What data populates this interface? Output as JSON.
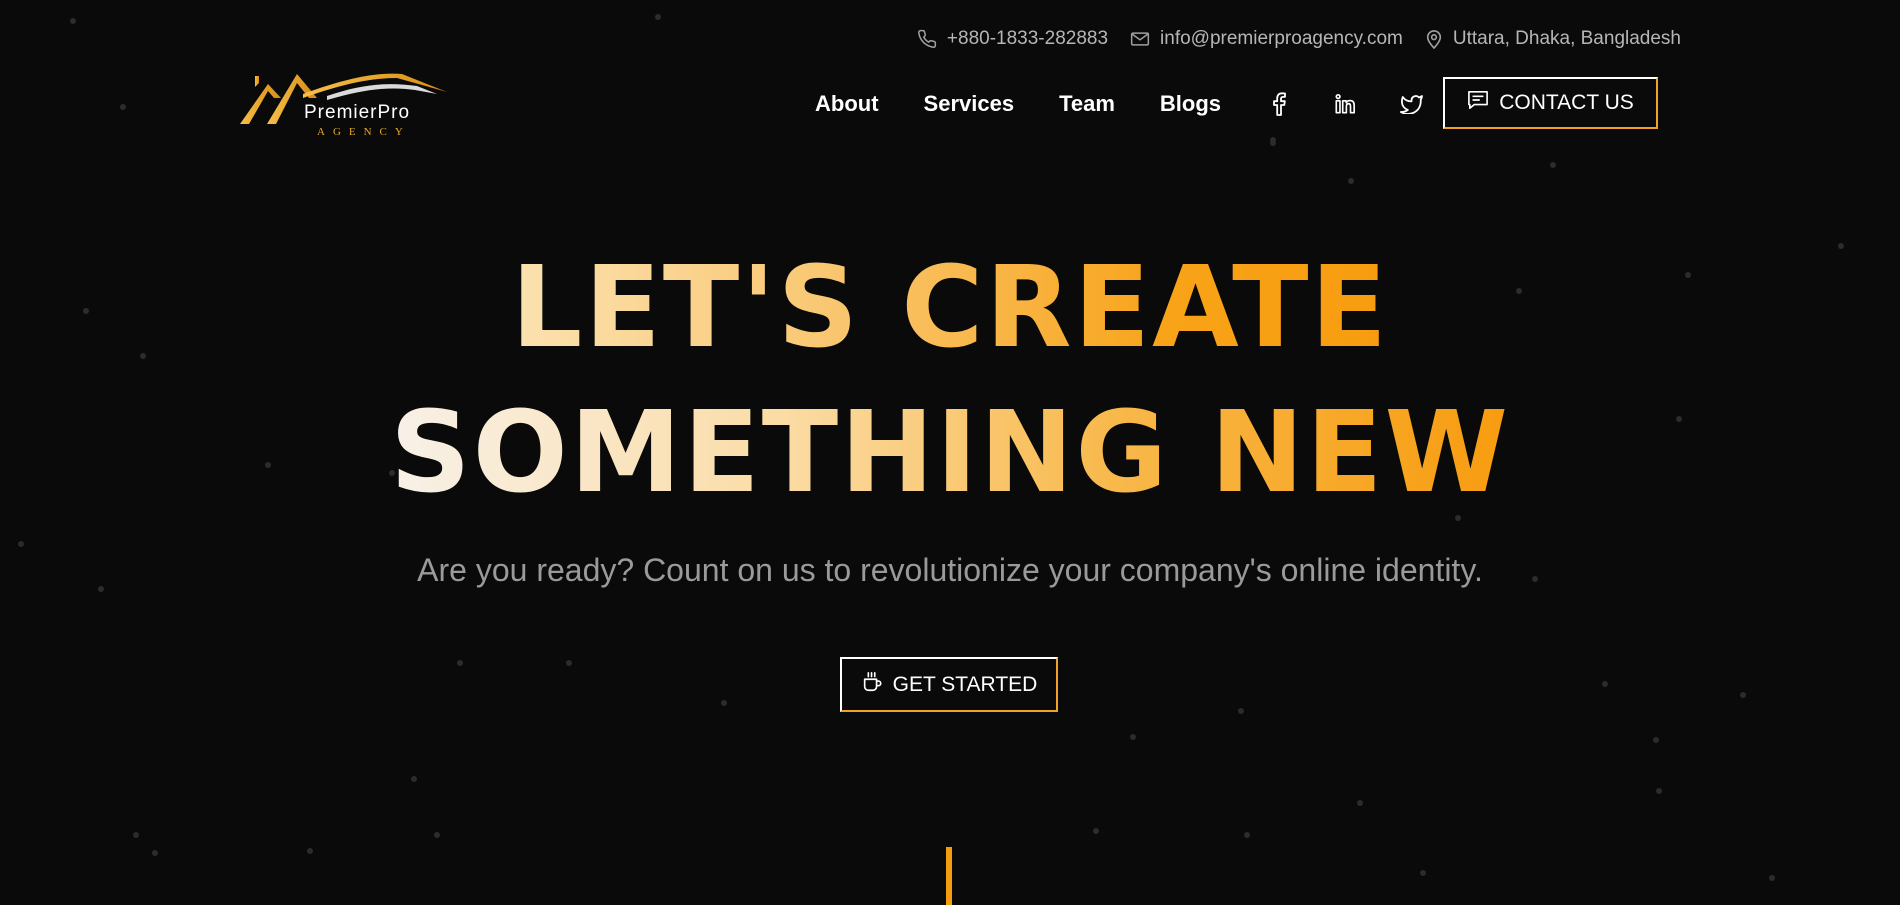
{
  "contact": {
    "phone": "+880-1833-282883",
    "email": "info@premierproagency.com",
    "address": "Uttara, Dhaka, Bangladesh"
  },
  "logo": {
    "name": "PremierPro",
    "sub": "AGENCY"
  },
  "nav": {
    "links": [
      "About",
      "Services",
      "Team",
      "Blogs"
    ],
    "social": [
      "facebook-icon",
      "linkedin-icon",
      "twitter-icon"
    ],
    "contact_label": "CONTACT US"
  },
  "hero": {
    "line1": "LET'S CREATE",
    "line2": "SOMETHING NEW",
    "subtitle": "Are you ready? Count on us to revolutionize your company's online identity.",
    "cta_label": "GET STARTED"
  },
  "colors": {
    "background": "#0a0a0a",
    "accent": "#f39c12",
    "text_muted": "#9a9a9a"
  }
}
